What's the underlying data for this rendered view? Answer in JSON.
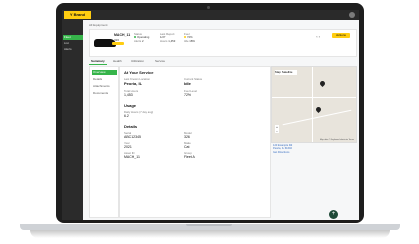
{
  "brand": {
    "logo_text": "Y Brand",
    "accent": "#ffcd11",
    "nav_active": "#36b44a"
  },
  "sidebar": {
    "items": [
      {
        "label": "Fleet"
      },
      {
        "label": "List"
      },
      {
        "label": "Alerts"
      }
    ]
  },
  "breadcrumb": "All Equipment",
  "header": {
    "machine_name": "MACH_11",
    "machine_sub": "326",
    "meta": [
      {
        "key": "Status",
        "value": "Operating"
      },
      {
        "key": "Last Report",
        "value": "1/27"
      },
      {
        "key": "Fuel",
        "value": "72%"
      },
      {
        "key": "Alerts",
        "value": "2"
      },
      {
        "key": "Hours",
        "value": "1,453"
      },
      {
        "key": "Idle",
        "value": "18%"
      }
    ],
    "nav_arrows": "‹  ›",
    "action_label": "Actions"
  },
  "tabs": [
    {
      "label": "Summary"
    },
    {
      "label": "Health"
    },
    {
      "label": "Utilization"
    },
    {
      "label": "Service"
    }
  ],
  "left_panel": {
    "items": [
      {
        "label": "Overview"
      },
      {
        "label": "Details"
      },
      {
        "label": "Attachments"
      },
      {
        "label": "Documents"
      }
    ]
  },
  "info": {
    "section1_title": "At Your Service",
    "fields": [
      {
        "label": "Last Known Location",
        "value": "Peoria, IL",
        "big": true
      },
      {
        "label": "Current Status",
        "value": "Idle",
        "big": true
      },
      {
        "label": "Total Hours",
        "value": "1,453"
      },
      {
        "label": "Fuel Level",
        "value": "72%"
      }
    ],
    "section2_title": "Usage",
    "usage_label": "Daily Hours (7 day avg)",
    "usage_value": "6.2",
    "section3_title": "Details",
    "details": [
      {
        "label": "Serial",
        "value": "ABC12345"
      },
      {
        "label": "Model",
        "value": "326"
      },
      {
        "label": "Year",
        "value": "2021"
      },
      {
        "label": "Make",
        "value": "Cat"
      },
      {
        "label": "Asset ID",
        "value": "MACH_11"
      },
      {
        "label": "Group",
        "value": "Fleet A"
      }
    ]
  },
  "map": {
    "toggle_map": "Map",
    "toggle_sat": "Satellite",
    "attribution": "Map data © Keyboard shortcuts Terms",
    "zoom_in": "+",
    "zoom_out": "−"
  },
  "location_text": [
    "123 Example Rd",
    "Peoria, IL 61602",
    "Get Directions"
  ],
  "fab_icon": "+"
}
